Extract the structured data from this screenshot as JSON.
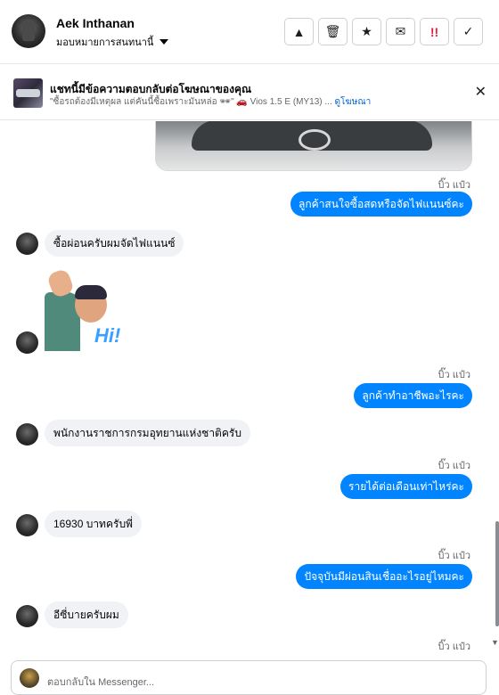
{
  "header": {
    "user_name": "Aek Inthanan",
    "assign_label": "มอบหมายการสนทนานี้",
    "actions": [
      {
        "icon": "warning-icon",
        "glyph": "▲"
      },
      {
        "icon": "trash-icon",
        "glyph": "🗑"
      },
      {
        "icon": "star-icon",
        "glyph": "★"
      },
      {
        "icon": "mail-icon",
        "glyph": "✉"
      },
      {
        "icon": "priority-icon",
        "glyph": "!!"
      },
      {
        "icon": "check-icon",
        "glyph": "✓"
      }
    ]
  },
  "ad_bar": {
    "title": "แชทนี้มีข้อความตอบกลับต่อโฆษณาของคุณ",
    "subtitle": "\"ซื้อรถต้องมีเหตุผล แต่คันนี้ซื้อเพราะมันหล่อ 🕶\" 🚗 Vios 1.5 E (MY13) ...",
    "link_label": "ดูโฆษณา",
    "close_glyph": "✕"
  },
  "messages": {
    "seen_label": "บิ๊ว แป๋ว",
    "out_1": "ลูกค้าสนใจซื้อสดหรือจัดไฟแนนซ์คะ",
    "in_1": "ซื้อผ่อนครับผมจัดไฟแนนซ์",
    "sticker_text": "Hi!",
    "out_2": "ลูกค้าทำอาชีพอะไรคะ",
    "in_2": "พนักงานราชการกรมอุทยานแห่งชาติครับ",
    "out_3": "รายได้ต่อเดือนเท่าไหร่คะ",
    "in_3": "16930 บาทครับพี่",
    "out_4": "ปัจจุบันมีผ่อนสินเชื่ออะไรอยู่ไหมคะ",
    "in_4": "อีซี่บายครับผม"
  },
  "composer": {
    "placeholder": "ตอบกลับใน Messenger..."
  },
  "colors": {
    "outgoing_bubble": "#0084ff",
    "incoming_bubble": "#f0f2f5",
    "link": "#0064d1",
    "priority_red": "#e41e3f"
  }
}
